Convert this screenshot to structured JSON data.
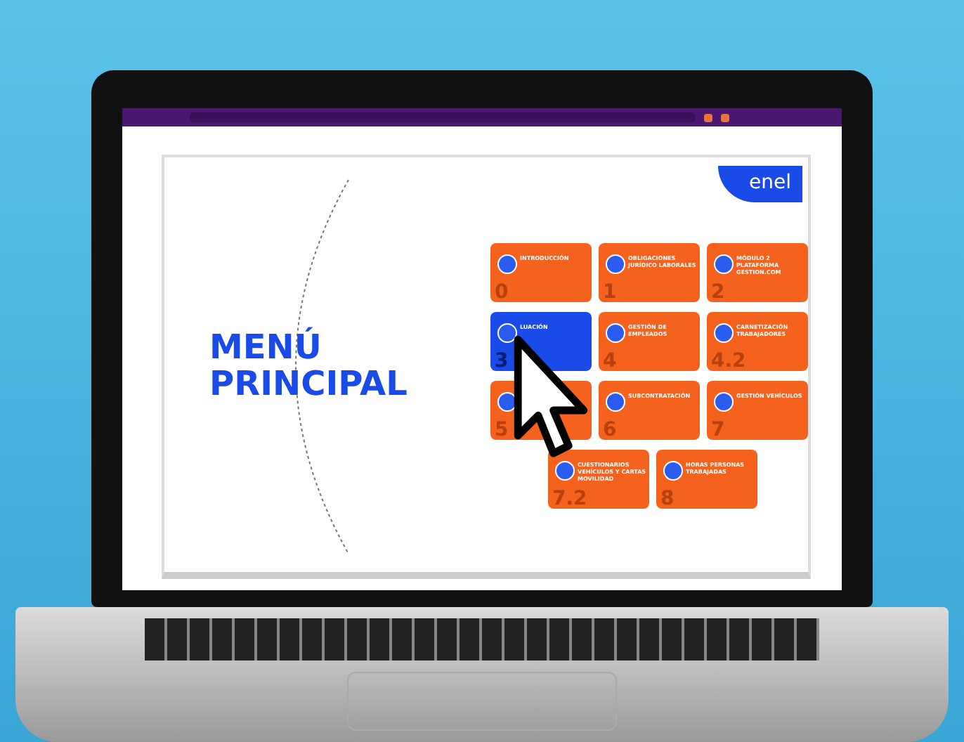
{
  "slide": {
    "title": "MENÚ PRINCIPAL",
    "logo": "enel",
    "tiles": [
      {
        "number": "0",
        "label": "INTRODUCCIÓN",
        "selected": false
      },
      {
        "number": "1",
        "label": "OBLIGACIONES JURÍDICO LABORALES",
        "selected": false
      },
      {
        "number": "2",
        "label": "MÓDULO 2 PLATAFORMA GESTION.COM",
        "selected": false
      },
      {
        "number": "3",
        "label": "LUACIÓN",
        "selected": true
      },
      {
        "number": "4",
        "label": "GESTIÓN DE EMPLEADOS",
        "selected": false
      },
      {
        "number": "4.2",
        "label": "CARNETIZACIÓN TRABAJADORES",
        "selected": false
      },
      {
        "number": "5",
        "selected": false
      },
      {
        "number": "6",
        "label": "SUBCONTRATACIÓN",
        "selected": false
      },
      {
        "number": "7",
        "label": "GESTIÓN VEHÍCULOS",
        "selected": false
      },
      {
        "number": "7.2",
        "label": "CUESTIONARIOS VEHÍCULOS Y CARTAS MOVILIDAD",
        "selected": false
      },
      {
        "number": "8",
        "label": "HORAS PERSONAS TRABAJADAS",
        "selected": false
      }
    ]
  }
}
